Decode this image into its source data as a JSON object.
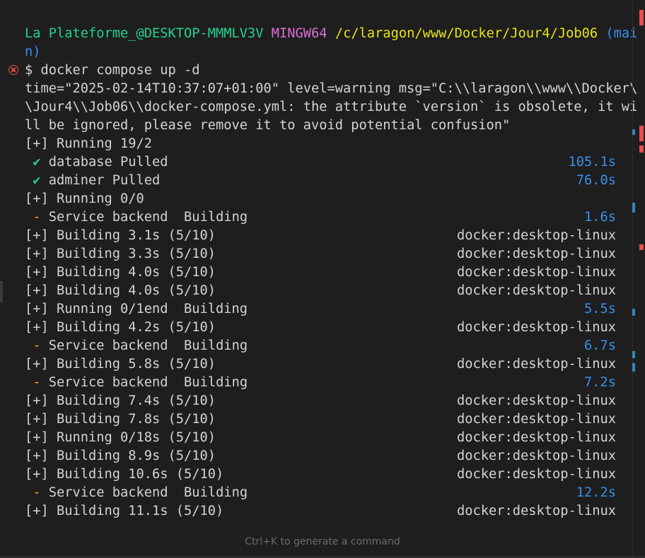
{
  "prompt": {
    "user_host": "La Plateforme_@DESKTOP-MMMLV3V",
    "shell": "MINGW64",
    "path": "/c/laragon/www/Docker/Jour4/Job06",
    "branch_part1": "(mai",
    "branch_part2": "n)"
  },
  "command": "$ docker compose up -d",
  "warning_lines": [
    "time=\"2025-02-14T10:37:07+01:00\" level=warning msg=\"C:\\\\laragon\\\\www\\\\Docker\\",
    "\\Jour4\\\\Job06\\\\docker-compose.yml: the attribute `version` is obsolete, it wi",
    "ll be ignored, please remove it to avoid potential confusion\""
  ],
  "rows": [
    {
      "kind": "plain",
      "text": "[+] Running 19/2",
      "right": ""
    },
    {
      "kind": "check",
      "mark": "✔",
      "text": "database Pulled",
      "right": "105.1s"
    },
    {
      "kind": "check",
      "mark": "✔",
      "text": "adminer Pulled",
      "right": "76.0s"
    },
    {
      "kind": "plain",
      "text": "[+] Running 0/0",
      "right": ""
    },
    {
      "kind": "dash",
      "mark": "-",
      "text": "Service backend  Building",
      "right": "1.6s"
    },
    {
      "kind": "build",
      "text": "[+] Building 3.1s (5/10)",
      "right": "docker:desktop-linux"
    },
    {
      "kind": "build",
      "text": "[+] Building 3.3s (5/10)",
      "right": "docker:desktop-linux"
    },
    {
      "kind": "build",
      "text": "[+] Building 4.0s (5/10)",
      "right": "docker:desktop-linux"
    },
    {
      "kind": "build",
      "text": "[+] Building 4.0s (5/10)",
      "right": "docker:desktop-linux"
    },
    {
      "kind": "plaintime",
      "text": "[+] Running 0/1end  Building",
      "right": "5.5s"
    },
    {
      "kind": "build",
      "text": "[+] Building 4.2s (5/10)",
      "right": "docker:desktop-linux"
    },
    {
      "kind": "dash",
      "mark": "-",
      "text": "Service backend  Building",
      "right": "6.7s"
    },
    {
      "kind": "build",
      "text": "[+] Building 5.8s (5/10)",
      "right": "docker:desktop-linux"
    },
    {
      "kind": "dash",
      "mark": "-",
      "text": "Service backend  Building",
      "right": "7.2s"
    },
    {
      "kind": "build",
      "text": "[+] Building 7.4s (5/10)",
      "right": "docker:desktop-linux"
    },
    {
      "kind": "build",
      "text": "[+] Building 7.8s (5/10)",
      "right": "docker:desktop-linux"
    },
    {
      "kind": "build",
      "text": "[+] Running 0/18s (5/10)",
      "right": "docker:desktop-linux"
    },
    {
      "kind": "build",
      "text": "[+] Building 8.9s (5/10)",
      "right": "docker:desktop-linux"
    },
    {
      "kind": "build",
      "text": "[+] Building 10.6s (5/10)",
      "right": "docker:desktop-linux"
    },
    {
      "kind": "dash",
      "mark": "-",
      "text": "Service backend  Building",
      "right": "12.2s"
    },
    {
      "kind": "build",
      "text": "[+] Building 11.1s (5/10)",
      "right": "docker:desktop-linux"
    }
  ],
  "hint": "Ctrl+K to generate a command",
  "colors": {
    "background": "#1e1e1e",
    "green": "#23d18b",
    "magenta": "#d670d6",
    "yellow": "#e5e510",
    "blue": "#3b8eea",
    "error": "#f14c4c"
  }
}
